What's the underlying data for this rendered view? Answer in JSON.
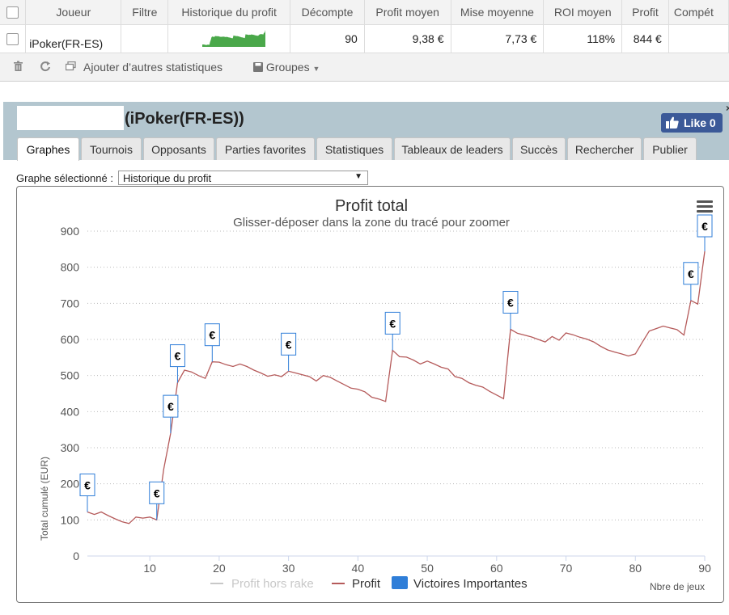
{
  "stats_table": {
    "columns": [
      "Joueur",
      "Filtre",
      "Historique du profit",
      "Décompte",
      "Profit moyen",
      "Mise moyenne",
      "ROI moyen",
      "Profit",
      "Compét"
    ],
    "row": {
      "player": "iPoker(FR-ES)",
      "filter": "",
      "count": "90",
      "avg_profit": "9,38 €",
      "avg_stake": "7,73 €",
      "avg_roi": "118%",
      "profit": "844 €"
    }
  },
  "toolbar": {
    "add_stats": "Ajouter d’autres statistiques",
    "groups": "Groupes"
  },
  "panel": {
    "player_name": "(iPoker(FR-ES))",
    "like_label": "Like 0",
    "close_glyph": "×",
    "tabs": [
      "Graphes",
      "Tournois",
      "Opposants",
      "Parties favorites",
      "Statistiques",
      "Tableaux de leaders",
      "Succès",
      "Rechercher",
      "Publier"
    ],
    "active_tab": "Graphes"
  },
  "graph_select": {
    "label": "Graphe sélectionné :",
    "value": "Historique du profit"
  },
  "chart_data": {
    "type": "line",
    "title": "Profit total",
    "subtitle": "Glisser-déposer dans la zone du tracé pour zoomer",
    "ylabel": "Total cumulé (EUR)",
    "xlabel": "Nbre de jeux",
    "xlim": [
      1,
      90
    ],
    "ylim": [
      0,
      900
    ],
    "x_ticks": [
      10,
      20,
      30,
      40,
      50,
      60,
      70,
      80,
      90
    ],
    "y_ticks": [
      0,
      100,
      200,
      300,
      400,
      500,
      600,
      700,
      800,
      900
    ],
    "grid": true,
    "legend": [
      "Profit hors rake",
      "Profit",
      "Victoires Importantes"
    ],
    "legend_position": "bottom",
    "series": [
      {
        "name": "Profit",
        "color": "#b55a5a",
        "x": [
          1,
          2,
          3,
          4,
          5,
          6,
          7,
          8,
          9,
          10,
          11,
          12,
          13,
          14,
          15,
          16,
          17,
          18,
          19,
          20,
          21,
          22,
          23,
          24,
          25,
          26,
          27,
          28,
          29,
          30,
          31,
          32,
          33,
          34,
          35,
          36,
          37,
          38,
          39,
          40,
          41,
          42,
          43,
          44,
          45,
          46,
          47,
          48,
          49,
          50,
          51,
          52,
          53,
          54,
          55,
          56,
          57,
          58,
          59,
          60,
          61,
          62,
          63,
          64,
          65,
          66,
          67,
          68,
          69,
          70,
          71,
          72,
          73,
          74,
          75,
          76,
          77,
          78,
          79,
          80,
          81,
          82,
          83,
          84,
          85,
          86,
          87,
          88,
          89,
          90
        ],
        "values": [
          122,
          115,
          122,
          112,
          103,
          95,
          90,
          108,
          105,
          108,
          100,
          240,
          340,
          480,
          515,
          510,
          500,
          492,
          538,
          537,
          530,
          525,
          532,
          525,
          515,
          507,
          498,
          502,
          497,
          512,
          507,
          502,
          497,
          485,
          500,
          495,
          485,
          475,
          465,
          462,
          455,
          440,
          435,
          428,
          570,
          552,
          551,
          543,
          532,
          540,
          532,
          523,
          518,
          497,
          492,
          480,
          473,
          468,
          456,
          446,
          436,
          628,
          617,
          612,
          607,
          600,
          593,
          608,
          598,
          618,
          613,
          606,
          601,
          593,
          581,
          571,
          565,
          560,
          554,
          560,
          592,
          623,
          630,
          637,
          632,
          627,
          612,
          708,
          698,
          844
        ]
      }
    ],
    "big_wins": [
      1,
      11,
      13,
      14,
      19,
      30,
      45,
      62,
      88,
      90
    ],
    "big_wins_label": "€",
    "colors": {
      "profit": "#b55a5a",
      "big_wins": "#2f7ed8",
      "rake": "#c8c8c8"
    }
  }
}
